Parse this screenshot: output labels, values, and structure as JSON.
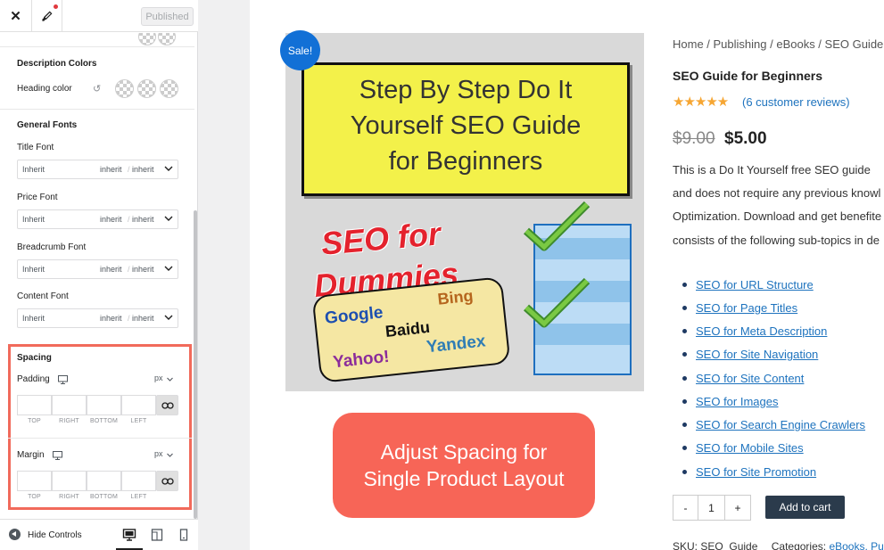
{
  "panel": {
    "published_label": "Published",
    "sections": {
      "description_colors": {
        "title": "Description Colors",
        "heading_color_label": "Heading color"
      },
      "general_fonts": {
        "title": "General Fonts",
        "fonts": [
          {
            "label": "Title Font",
            "family": "Inherit",
            "size": "inherit",
            "weight": "inherit"
          },
          {
            "label": "Price Font",
            "family": "Inherit",
            "size": "inherit",
            "weight": "inherit"
          },
          {
            "label": "Breadcrumb Font",
            "family": "Inherit",
            "size": "inherit",
            "weight": "inherit"
          },
          {
            "label": "Content Font",
            "family": "Inherit",
            "size": "inherit",
            "weight": "inherit"
          }
        ],
        "separator": "/"
      },
      "spacing": {
        "title": "Spacing",
        "padding": {
          "label": "Padding",
          "unit": "px"
        },
        "margin": {
          "label": "Margin",
          "unit": "px"
        },
        "side_labels": [
          "TOP",
          "RIGHT",
          "BOTTOM",
          "LEFT"
        ]
      }
    },
    "bottom": {
      "hide_controls": "Hide Controls"
    },
    "highlight_color": "#f16a5b"
  },
  "preview": {
    "sale_badge": "Sale!",
    "image_text": {
      "board_lines": [
        "Step By Step Do It",
        "Yourself SEO Guide",
        "for Beginners"
      ],
      "dummies_lines": [
        "SEO for",
        "Dummies"
      ],
      "engines": [
        "Google",
        "Bing",
        "Baidu",
        "Yandex",
        "Yahoo!"
      ]
    },
    "cta": {
      "line1": "Adjust Spacing for",
      "line2": "Single Product Layout",
      "color": "#f76557"
    },
    "breadcrumb": "Home / Publishing / eBooks / SEO Guide for",
    "title": "SEO Guide for Beginners",
    "stars": "★★★★★",
    "rating": 4.5,
    "reviews": "(6 customer reviews)",
    "old_price": "$9.00",
    "new_price": "$5.00",
    "description": [
      "This is a Do It Yourself free SEO guide",
      "and does not require any previous knowl",
      "Optimization. Download and get benefite",
      "consists of the following sub-topics in de"
    ],
    "topics": [
      "SEO for URL Structure",
      "SEO for Page Titles",
      "SEO for Meta Description",
      "SEO for Site Navigation",
      "SEO for Site Content",
      "SEO for Images",
      "SEO for Search Engine Crawlers",
      "SEO for Mobile Sites",
      "SEO for Site Promotion"
    ],
    "qty": {
      "minus": "-",
      "value": "1",
      "plus": "+"
    },
    "add_to_cart": "Add to cart",
    "sku_label": "SKU: SEO_Guide",
    "categories_label": "Categories:",
    "categories_value": "eBooks, Pub"
  }
}
